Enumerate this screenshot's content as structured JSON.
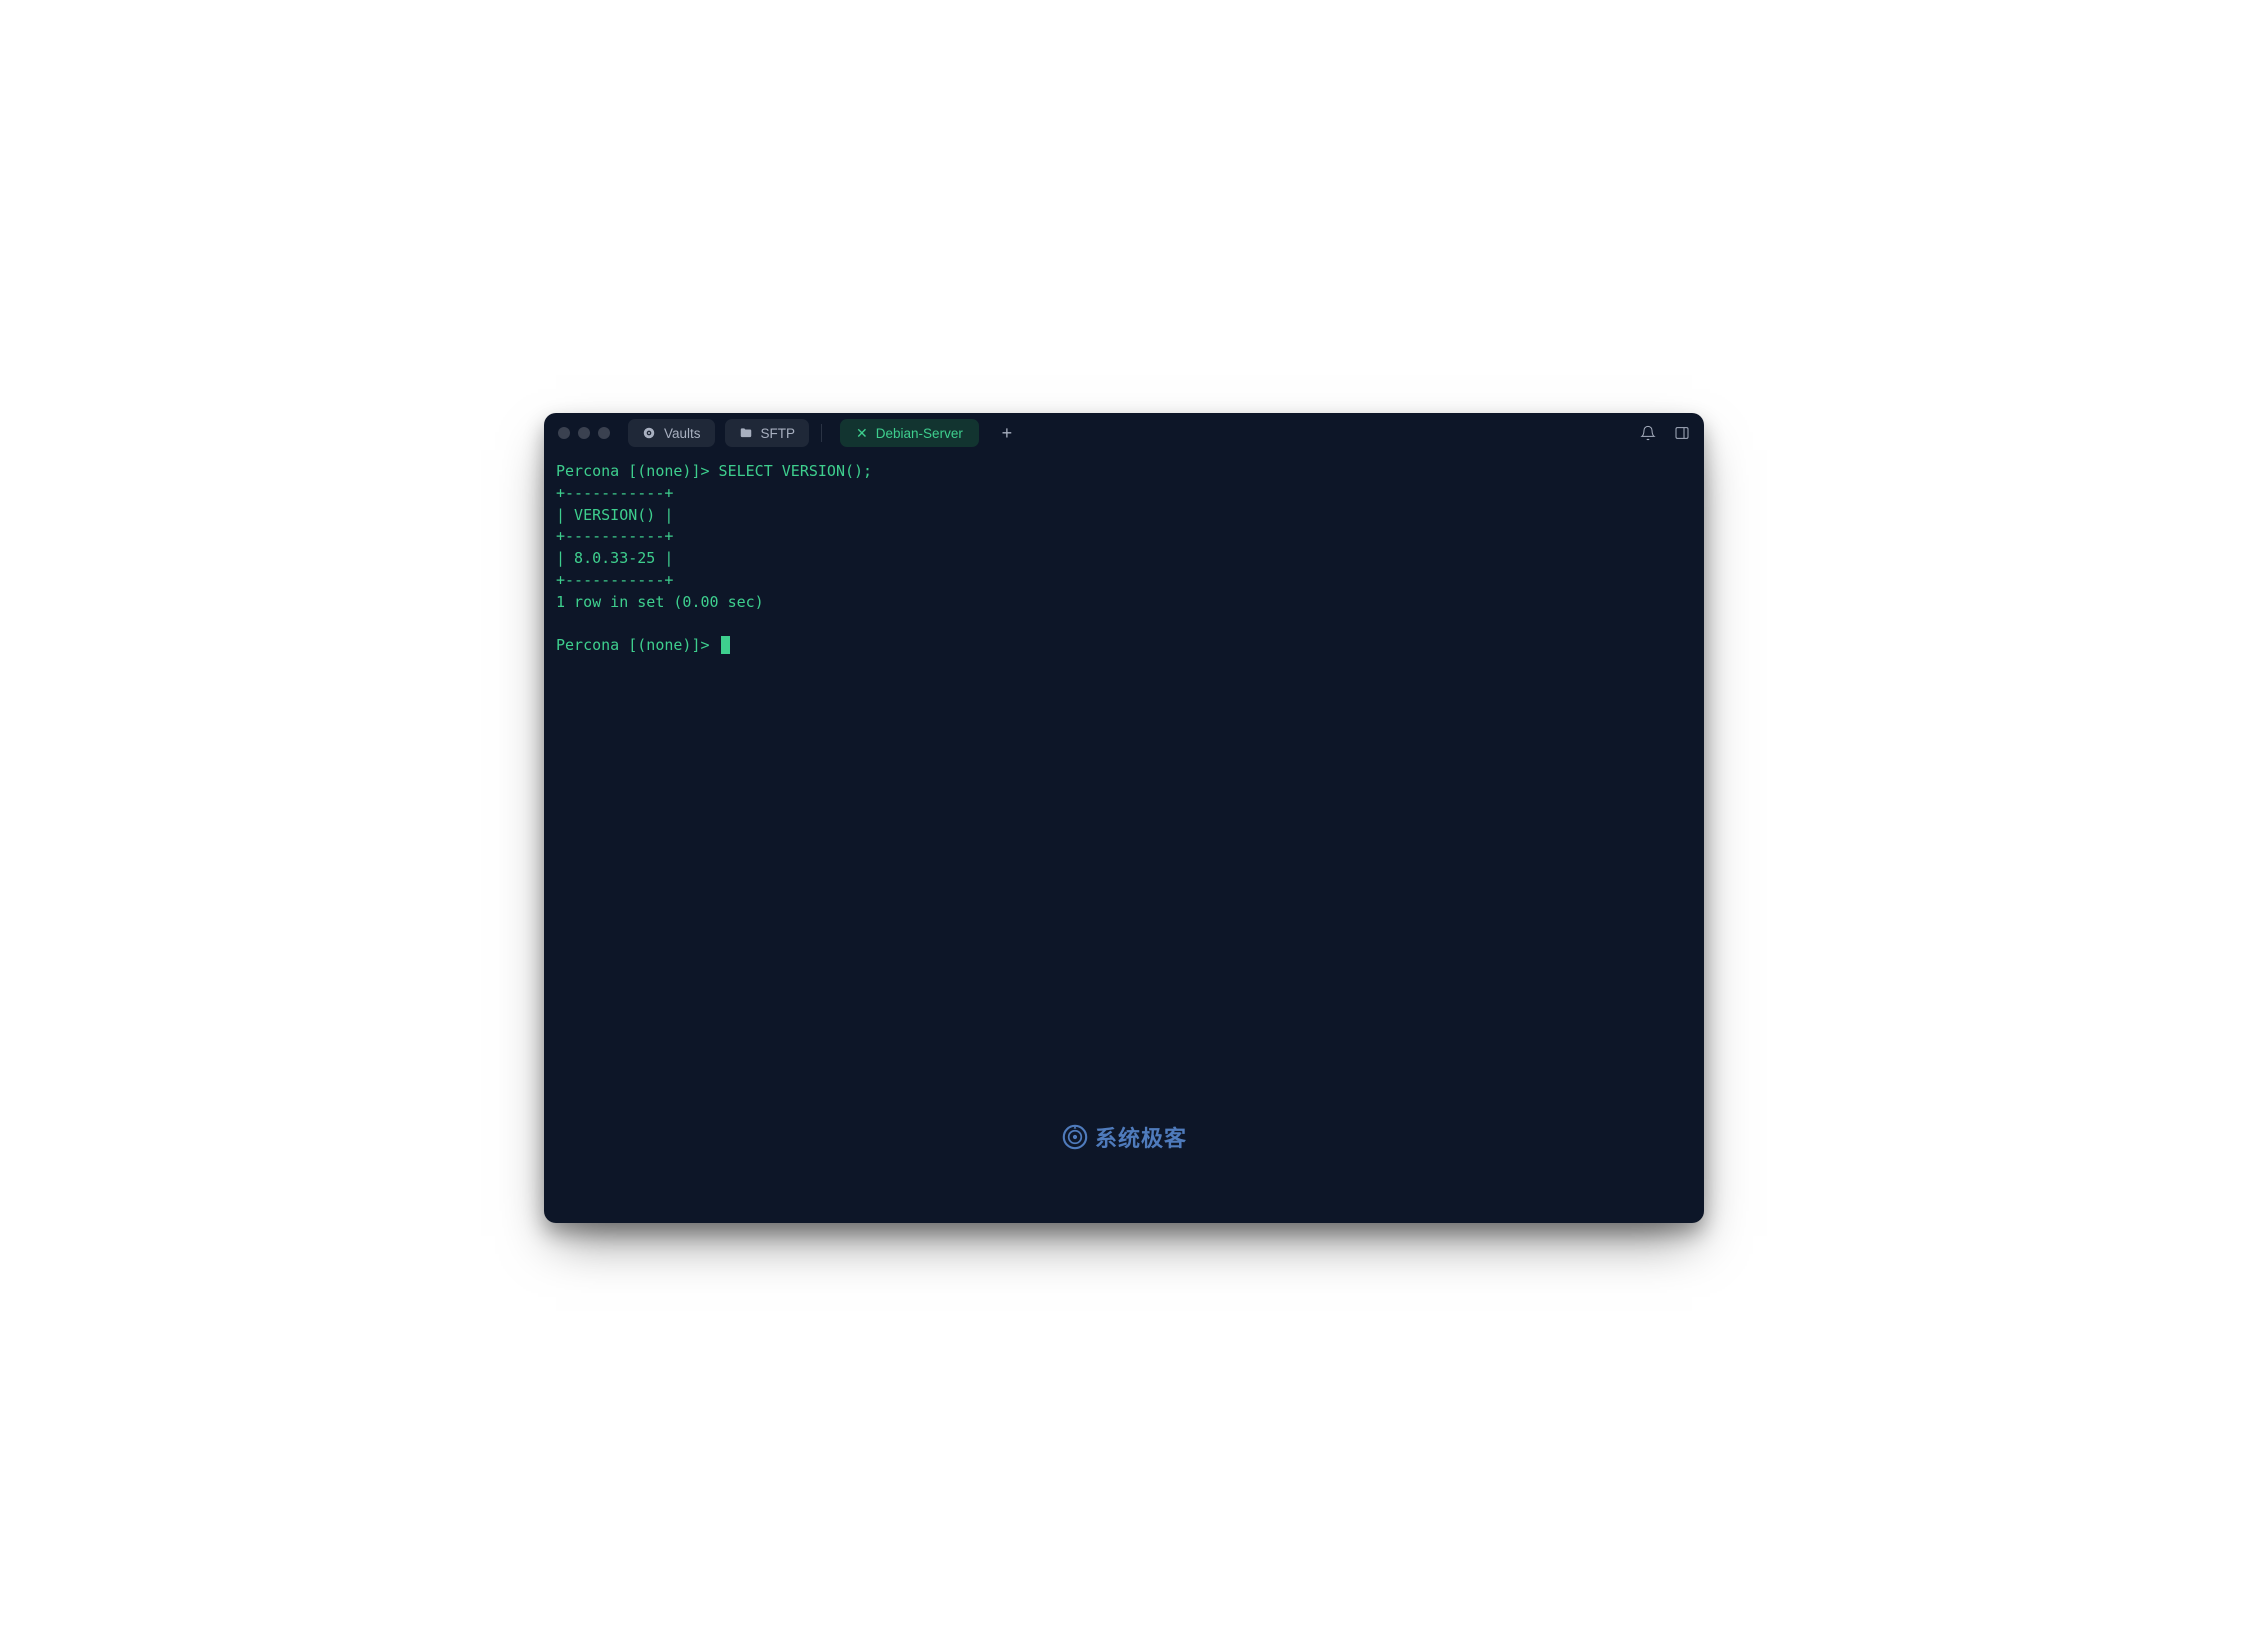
{
  "tabs": {
    "vaults": {
      "label": "Vaults"
    },
    "sftp": {
      "label": "SFTP"
    },
    "active": {
      "label": "Debian-Server"
    }
  },
  "terminal": {
    "line1": "Percona [(none)]> SELECT VERSION();",
    "line2": "+-----------+",
    "line3": "| VERSION() |",
    "line4": "+-----------+",
    "line5": "| 8.0.33-25 |",
    "line6": "+-----------+",
    "line7": "1 row in set (0.00 sec)",
    "line8": "",
    "prompt": "Percona [(none)]> "
  },
  "watermark": {
    "text": "系统极客"
  }
}
